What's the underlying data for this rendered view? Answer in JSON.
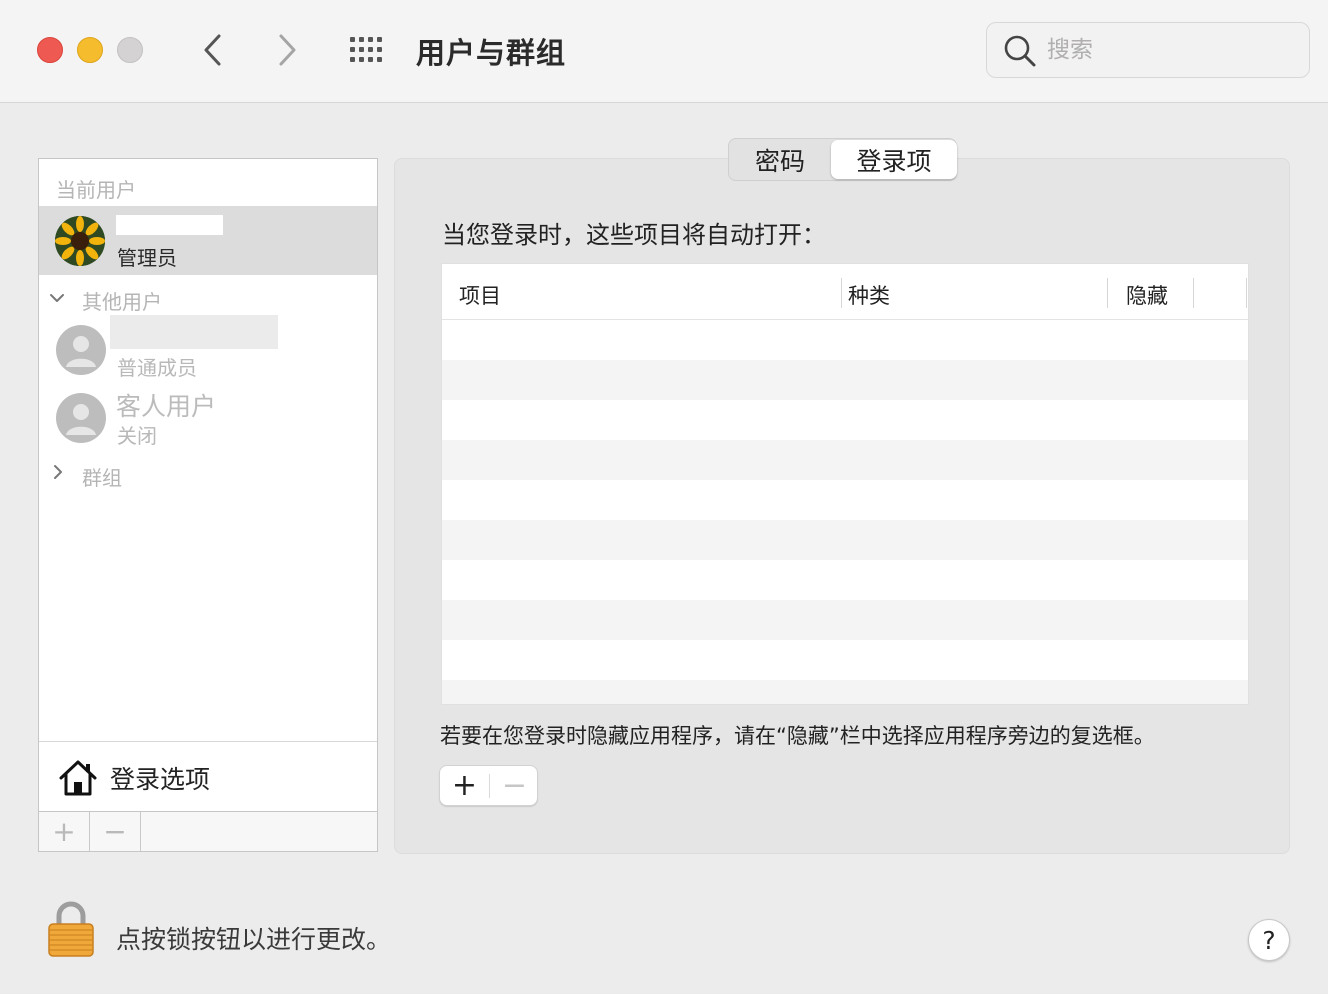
{
  "window": {
    "title": "用户与群组",
    "search_placeholder": "搜索"
  },
  "colors": {
    "close": "#ee5a52",
    "minimize": "#f5bd2e",
    "zoom_disabled": "#d4d2d2",
    "selected_row": "#dcdcdc"
  },
  "sidebar": {
    "current_users_label": "当前用户",
    "current_user": {
      "role": "管理员"
    },
    "other_users_label": "其他用户",
    "other_users": [
      {
        "role": "普通成员"
      },
      {
        "name": "客人用户",
        "role": "关闭"
      }
    ],
    "groups_label": "群组",
    "login_options_label": "登录选项",
    "add_label": "+",
    "remove_label": "−"
  },
  "tabs": [
    {
      "label": "密码",
      "selected": false
    },
    {
      "label": "登录项",
      "selected": true
    }
  ],
  "main": {
    "intro": "当您登录时，这些项目将自动打开：",
    "columns": [
      "项目",
      "种类",
      "隐藏"
    ],
    "hint": "若要在您登录时隐藏应用程序，请在“隐藏”栏中选择应用程序旁边的复选框。",
    "add_label": "+",
    "remove_label": "−"
  },
  "footer": {
    "lock_text": "点按锁按钮以进行更改。",
    "help_label": "?"
  }
}
